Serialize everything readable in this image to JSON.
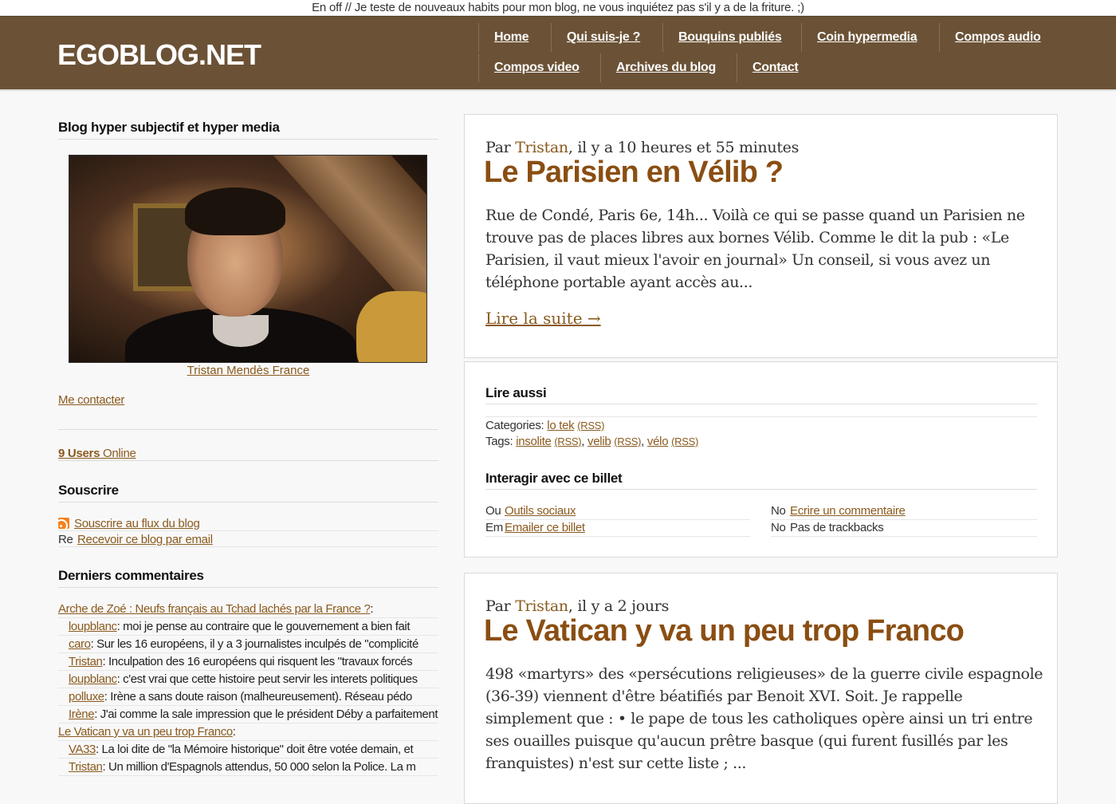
{
  "notice": "En off // Je teste de nouveaux habits pour mon blog, ne vous inquiétez pas s'il y a de la friture. ;)",
  "site": {
    "logo": "EGOBLOG.NET"
  },
  "nav": {
    "items": [
      "Home",
      "Qui suis-je ?",
      "Bouquins publiés",
      "Coin hypermedia",
      "Compos audio",
      "Compos video",
      "Archives du blog",
      "Contact"
    ]
  },
  "sidebar": {
    "heading": "Blog hyper subjectif et hyper media",
    "photo_caption": "Tristan Mendès France",
    "contact_link": "Me contacter",
    "users_online": "9 Users",
    "users_online_suffix": " Online",
    "subscribe_heading": "Souscrire",
    "subscribe_feed": "Souscrire au flux du blog",
    "subscribe_email_icon": "Re",
    "subscribe_email": "Recevoir ce blog par email",
    "comments_heading": "Derniers commentaires",
    "comments": [
      {
        "author": "Arche de Zoé : Neufs français au Tchad lachés par la France ?",
        "text": ":",
        "indent": false
      },
      {
        "author": "loupblanc",
        "text": ": moi je pense au contraire que le gouvernement a bien fait",
        "indent": true
      },
      {
        "author": "caro",
        "text": ": Sur les 16 européens, il y a 3 journalistes inculpés de \"complicité",
        "indent": true
      },
      {
        "author": "Tristan",
        "text": ": Inculpation des 16 européens qui risquent les \"travaux forcés",
        "indent": true
      },
      {
        "author": "loupblanc",
        "text": ": c'est vrai  que cette histoire peut servir les interets politiques",
        "indent": true
      },
      {
        "author": "polluxe",
        "text": ": Irène a sans doute raison (malheureusement). Réseau pédo",
        "indent": true
      },
      {
        "author": "Irène",
        "text": ": J'ai comme la sale impression que le président Déby a parfaitement",
        "indent": true
      },
      {
        "author": "Le Vatican y va un peu trop Franco",
        "text": ":",
        "indent": false
      },
      {
        "author": "VA33",
        "text": ": La loi dite de \"la Mémoire historique\" doit être votée demain, et",
        "indent": true
      },
      {
        "author": "Tristan",
        "text": ": Un million d'Espagnols attendus, 50 000 selon la Police. La m",
        "indent": true
      }
    ]
  },
  "post1": {
    "meta_prefix": "Par ",
    "author": "Tristan",
    "meta_suffix": ", il y a 10 heures et 55 minutes",
    "title": "Le Parisien en Vélib ?",
    "excerpt": "Rue de Condé, Paris 6e, 14h... Voilà ce qui se passe quand un Parisien ne trouve pas de places libres aux bornes Vélib. Comme le dit la pub : «Le Parisien, il vaut mieux l'avoir en journal» Un conseil, si vous avez un téléphone portable ayant accès au...",
    "read_more": "Lire la suite →"
  },
  "related": {
    "heading": "Lire aussi",
    "categories_label": "Categories: ",
    "category": "lo tek",
    "rss": "(RSS)",
    "tags_label": "Tags: ",
    "tags": [
      "insolite",
      "velib",
      "vélo"
    ],
    "interact_heading": "Interagir avec ce billet",
    "actions": {
      "social_icon": "Ou",
      "social": "Outils sociaux",
      "email_icon": "Em",
      "email": "Emailer ce billet",
      "comment_icon": "No",
      "comment": "Ecrire un commentaire",
      "trackback_icon": "No",
      "trackback": "Pas de trackbacks"
    }
  },
  "post2": {
    "meta_prefix": "Par ",
    "author": "Tristan",
    "meta_suffix": ", il y a 2 jours",
    "title": "Le Vatican y va un peu trop Franco",
    "excerpt": "498 «martyrs» des «persécutions religieuses» de la guerre civile espagnole (36-39) viennent d'être béatifiés par Benoit XVI. Soit. Je rappelle simplement que : • le pape de tous les catholiques opère ainsi un tri entre ses ouailles puisque qu'aucun prêtre basque (qui furent fusillés par les franquistes) n'est sur cette liste ; ..."
  },
  "colors": {
    "header": "#6b5236",
    "link": "#8a5a1e",
    "title": "#8a4e12"
  }
}
